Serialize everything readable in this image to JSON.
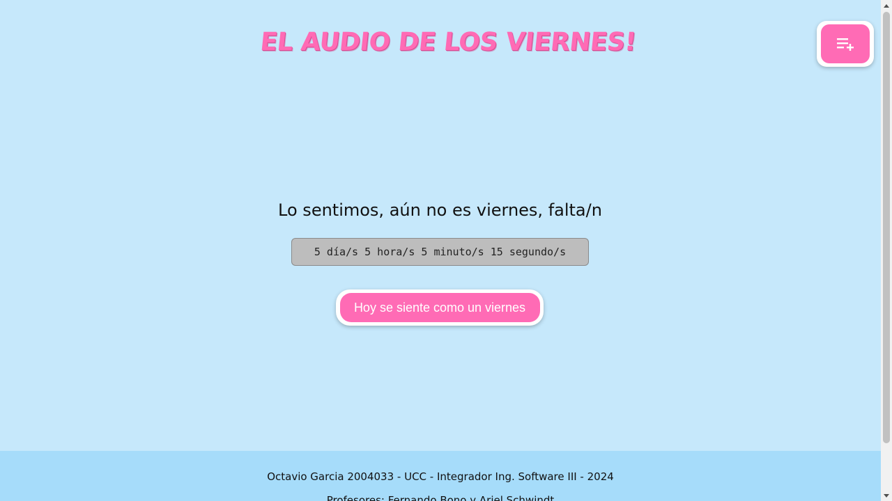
{
  "header": {
    "title": "EL AUDIO DE LOS VIERNES!",
    "playlist_button_icon": "playlist-add-icon"
  },
  "main": {
    "message": "Lo sentimos, aún no es viernes, falta/n",
    "countdown": "5 día/s 5 hora/s 5 minuto/s 15 segundo/s",
    "friday_button_label": "Hoy se siente como un viernes"
  },
  "footer": {
    "credits": "Octavio Garcia 2004033 - UCC - Integrador Ing. Software III - 2024",
    "professors": "Profesores: Fernando Bono y Ariel Schwindt"
  },
  "colors": {
    "background": "#c6e8fb",
    "footer_background": "#a6dcfa",
    "accent_pink": "#ff6bb5",
    "countdown_background": "#bdbdbd"
  }
}
